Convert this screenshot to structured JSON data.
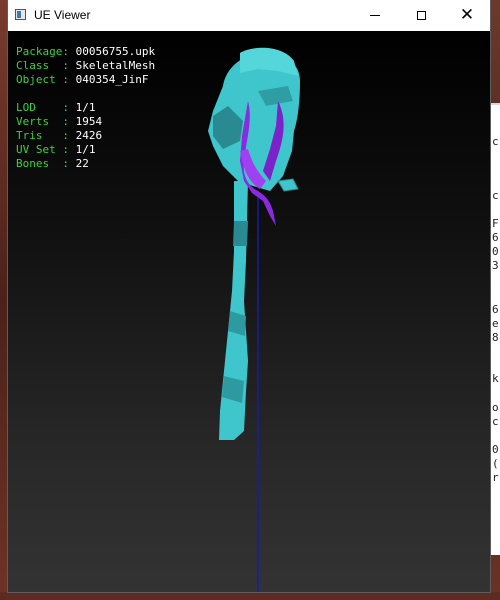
{
  "window": {
    "title": "UE Viewer",
    "buttons": {
      "minimize": "minimize",
      "maximize": "maximize",
      "close": "close"
    }
  },
  "info": {
    "rows": [
      {
        "label": "Package: ",
        "value": "00056755.upk"
      },
      {
        "label": "Class  : ",
        "value": "SkeletalMesh"
      },
      {
        "label": "Object : ",
        "value": "040354_JinF"
      }
    ],
    "stats": [
      {
        "label": "LOD    : ",
        "value": "1/1"
      },
      {
        "label": "Verts  : ",
        "value": "1954"
      },
      {
        "label": "Tris   : ",
        "value": "2426"
      },
      {
        "label": "UV Set : ",
        "value": "1/1"
      },
      {
        "label": "Bones  : ",
        "value": "22"
      }
    ]
  },
  "background_window_chars": [
    "c",
    "c",
    "F",
    "6",
    "0",
    "3",
    "6",
    "e",
    "8",
    "k",
    "o",
    "c",
    "0",
    "(",
    "r"
  ],
  "colors": {
    "label_green": "#3cd23c",
    "value_white": "#ffffff",
    "mesh_cyan": "#3fc6cc",
    "hair_purple": "#8a2be2",
    "bone_line_blue": "#1a1aa8"
  }
}
